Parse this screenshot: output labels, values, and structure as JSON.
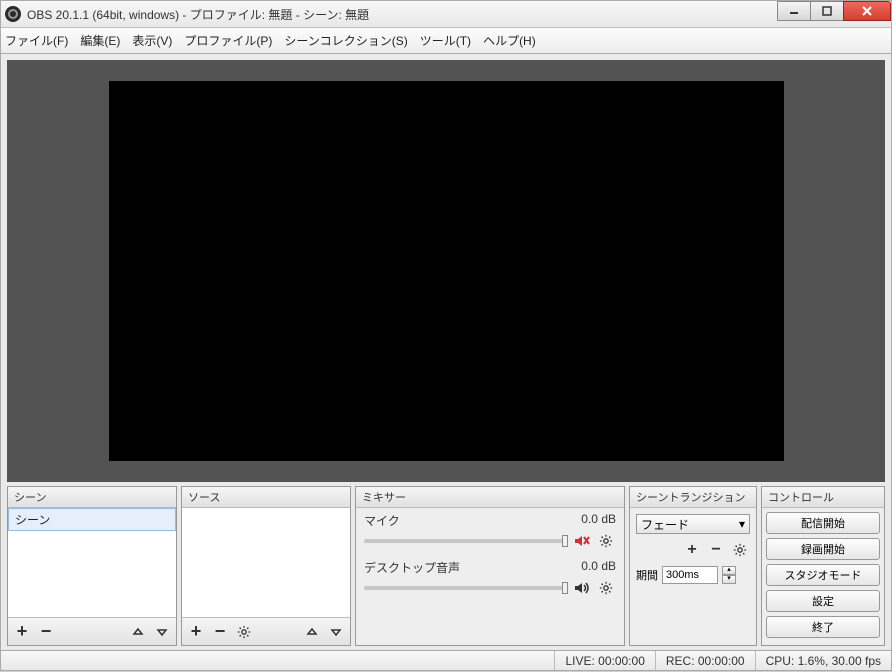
{
  "window": {
    "title": "OBS 20.1.1 (64bit, windows) - プロファイル: 無題 - シーン: 無題"
  },
  "menu": {
    "file": "ファイル(F)",
    "edit": "編集(E)",
    "view": "表示(V)",
    "profile": "プロファイル(P)",
    "sceneCollection": "シーンコレクション(S)",
    "tools": "ツール(T)",
    "help": "ヘルプ(H)"
  },
  "panels": {
    "scenes": {
      "title": "シーン",
      "items": [
        "シーン"
      ]
    },
    "sources": {
      "title": "ソース"
    },
    "mixer": {
      "title": "ミキサー",
      "channels": [
        {
          "name": "マイク",
          "level": "0.0 dB",
          "muted": true
        },
        {
          "name": "デスクトップ音声",
          "level": "0.0 dB",
          "muted": false
        }
      ]
    },
    "transitions": {
      "title": "シーントランジション",
      "selected": "フェード",
      "durationLabel": "期間",
      "duration": "300ms"
    },
    "controls": {
      "title": "コントロール",
      "buttons": {
        "startStream": "配信開始",
        "startRecord": "録画開始",
        "studioMode": "スタジオモード",
        "settings": "設定",
        "exit": "終了"
      }
    }
  },
  "status": {
    "live": "LIVE: 00:00:00",
    "rec": "REC: 00:00:00",
    "cpu": "CPU: 1.6%, 30.00 fps"
  }
}
